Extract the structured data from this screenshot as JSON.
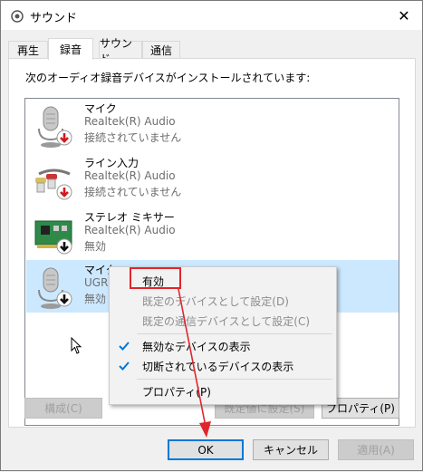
{
  "window": {
    "title": "サウンド",
    "close_glyph": "✕"
  },
  "tabs": [
    {
      "label": "再生",
      "active": false
    },
    {
      "label": "録音",
      "active": true
    },
    {
      "label": "サウンド",
      "active": false
    },
    {
      "label": "通信",
      "active": false
    }
  ],
  "panel": {
    "instruction": "次のオーディオ録音デバイスがインストールされています:"
  },
  "devices": [
    {
      "name": "マイク",
      "driver": "Realtek(R) Audio",
      "status": "接続されていません",
      "icon": "microphone-icon",
      "badge": "red-down-arrow-icon",
      "selected": false
    },
    {
      "name": "ライン入力",
      "driver": "Realtek(R) Audio",
      "status": "接続されていません",
      "icon": "line-in-cable-icon",
      "badge": "red-down-arrow-icon",
      "selected": false
    },
    {
      "name": "ステレオ ミキサー",
      "driver": "Realtek(R) Audio",
      "status": "無効",
      "icon": "sound-card-icon",
      "badge": "black-down-arrow-icon",
      "selected": false
    },
    {
      "name": "マイク",
      "driver": "UGRE",
      "status": "無効",
      "icon": "microphone-icon",
      "badge": "black-down-arrow-icon",
      "selected": true
    }
  ],
  "panel_buttons": {
    "configure": "構成(C)",
    "set_default": "既定値に設定(S)",
    "properties": "プロパティ(P)"
  },
  "context_menu": {
    "enable": "有効",
    "set_default_device": "既定のデバイスとして設定(D)",
    "set_default_comm": "既定の通信デバイスとして設定(C)",
    "show_disabled": "無効なデバイスの表示",
    "show_disconnected": "切断されているデバイスの表示",
    "properties": "プロパティ(P)"
  },
  "dialog_buttons": {
    "ok": "OK",
    "cancel": "キャンセル",
    "apply": "適用(A)"
  },
  "colors": {
    "accent": "#0078d7",
    "selection": "#cce8ff",
    "annotation": "#e0262d"
  }
}
